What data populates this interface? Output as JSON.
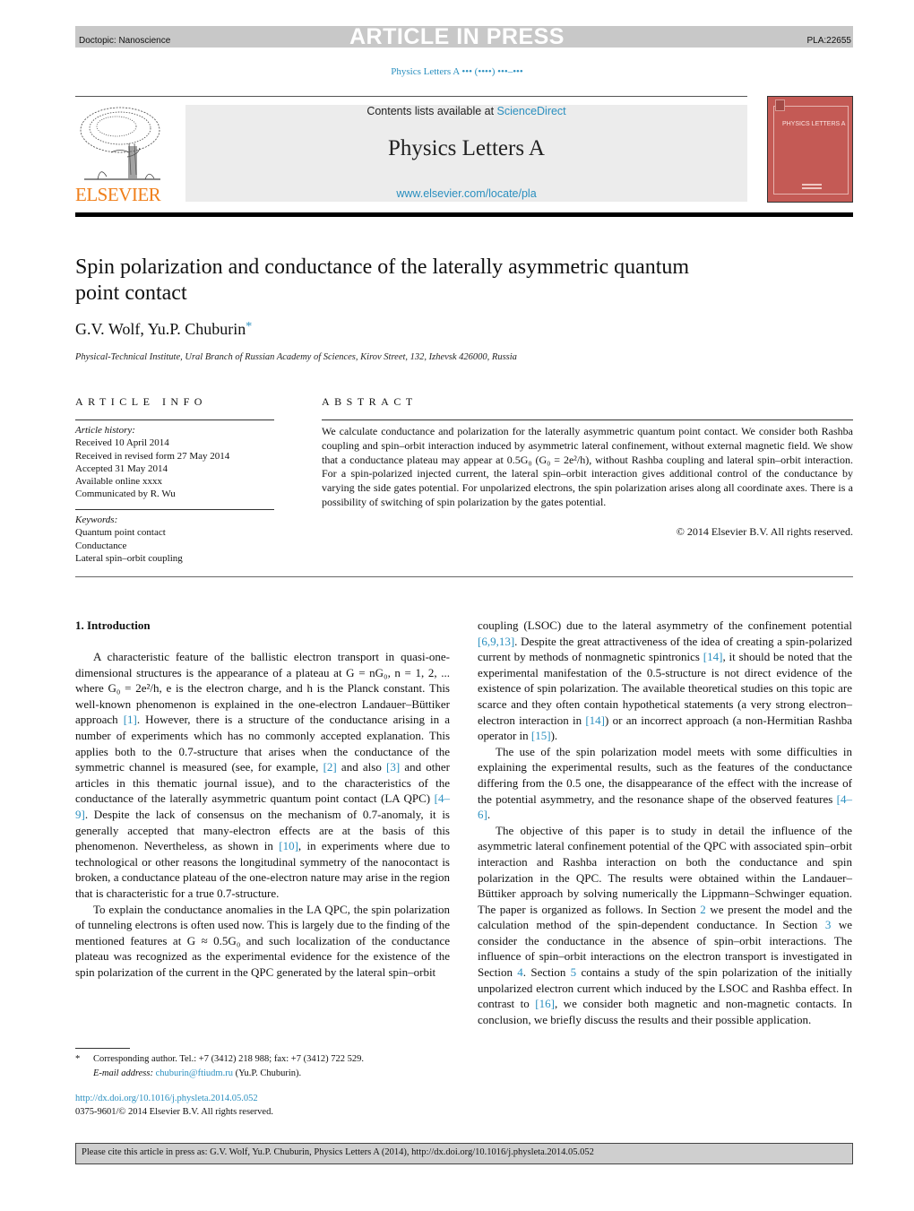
{
  "header": {
    "doctopic": "Doctopic: Nanoscience",
    "press_label": "ARTICLE IN PRESS",
    "article_code": "PLA:22655",
    "journal_citation": "Physics Letters A ••• (••••) •••–•••"
  },
  "masthead": {
    "contents_prefix": "Contents lists available at ",
    "contents_link": "ScienceDirect",
    "journal_name": "Physics Letters A",
    "journal_url": "www.elsevier.com/locate/pla",
    "publisher": "ELSEVIER",
    "cover_title": "PHYSICS LETTERS A",
    "cover_color": "#c45a55",
    "publisher_color": "#f07f1a",
    "link_color": "#2a8fbf"
  },
  "article": {
    "title": "Spin polarization and conductance of the laterally asymmetric quantum point contact",
    "authors": "G.V. Wolf, Yu.P. Chuburin",
    "author_marker": "*",
    "affiliation": "Physical-Technical Institute, Ural Branch of Russian Academy of Sciences, Kirov Street, 132, Izhevsk 426000, Russia"
  },
  "article_info": {
    "heading": "ARTICLE INFO",
    "history_label": "Article history:",
    "history": [
      "Received 10 April 2014",
      "Received in revised form 27 May 2014",
      "Accepted 31 May 2014",
      "Available online xxxx",
      "Communicated by R. Wu"
    ],
    "keywords_label": "Keywords:",
    "keywords": [
      "Quantum point contact",
      "Conductance",
      "Lateral spin–orbit coupling"
    ]
  },
  "abstract": {
    "heading": "ABSTRACT",
    "text": "We calculate conductance and polarization for the laterally asymmetric quantum point contact. We consider both Rashba coupling and spin–orbit interaction induced by asymmetric lateral confinement, without external magnetic field. We show that a conductance plateau may appear at 0.5G₀ (G₀ = 2e²/h), without Rashba coupling and lateral spin–orbit interaction. For a spin-polarized injected current, the lateral spin–orbit interaction gives additional control of the conductance by varying the side gates potential. For unpolarized electrons, the spin polarization arises along all coordinate axes. There is a possibility of switching of spin polarization by the gates potential.",
    "copyright": "© 2014 Elsevier B.V. All rights reserved."
  },
  "body": {
    "section_heading": "1. Introduction",
    "left_col": [
      {
        "t": "A characteristic feature of the ballistic electron transport in quasi-one-dimensional structures is the appearance of a plateau at G = nG₀, n = 1, 2, ... where G₀ = 2e²/h, e is the electron charge, and h is the Planck constant. This well-known phenomenon is explained in the one-electron Landauer–Büttiker approach "
      },
      {
        "l": "[1]"
      },
      {
        "t": ". However, there is a structure of the conductance arising in a number of experiments which has no commonly accepted explanation. This applies both to the 0.7-structure that arises when the conductance of the symmetric channel is measured (see, for example, "
      },
      {
        "l": "[2]"
      },
      {
        "t": " and also "
      },
      {
        "l": "[3]"
      },
      {
        "t": " and other articles in this thematic journal issue), and to the characteristics of the conductance of the laterally asymmetric quantum point contact (LA QPC) "
      },
      {
        "l": "[4–9]"
      },
      {
        "t": ". Despite the lack of consensus on the mechanism of 0.7-anomaly, it is generally accepted that many-electron effects are at the basis of this phenomenon. Nevertheless, as shown in "
      },
      {
        "l": "[10]"
      },
      {
        "t": ", in experiments where due to technological or other reasons the longitudinal symmetry of the nanocontact is broken, a conductance plateau of the one-electron nature may arise in the region that is characteristic for a true 0.7-structure."
      }
    ],
    "left_col_p2": "To explain the conductance anomalies in the LA QPC, the spin polarization of tunneling electrons is often used now. This is largely due to the finding of the mentioned features at G ≈ 0.5G₀ and such localization of the conductance plateau was recognized as the experimental evidence for the existence of the spin polarization of the current in the QPC generated by the lateral spin–orbit",
    "right_p1": [
      {
        "t": "coupling (LSOC) due to the lateral asymmetry of the confinement potential "
      },
      {
        "l": "[6,9,13]"
      },
      {
        "t": ". Despite the great attractiveness of the idea of creating a spin-polarized current by methods of nonmagnetic spintronics "
      },
      {
        "l": "[14]"
      },
      {
        "t": ", it should be noted that the experimental manifestation of the 0.5-structure is not direct evidence of the existence of spin polarization. The available theoretical studies on this topic are scarce and they often contain hypothetical statements (a very strong electron–electron interaction in "
      },
      {
        "l": "[14]"
      },
      {
        "t": ") or an incorrect approach (a non-Hermitian Rashba operator in "
      },
      {
        "l": "[15]"
      },
      {
        "t": ")."
      }
    ],
    "right_p2": [
      {
        "t": "The use of the spin polarization model meets with some difficulties in explaining the experimental results, such as the features of the conductance differing from the 0.5 one, the disappearance of the effect with the increase of the potential asymmetry, and the resonance shape of the observed features "
      },
      {
        "l": "[4–6]"
      },
      {
        "t": "."
      }
    ],
    "right_p3": [
      {
        "t": "The objective of this paper is to study in detail the influence of the asymmetric lateral confinement potential of the QPC with associated spin–orbit interaction and Rashba interaction on both the conductance and spin polarization in the QPC. The results were obtained within the Landauer–Büttiker approach by solving numerically the Lippmann–Schwinger equation. The paper is organized as follows. In Section "
      },
      {
        "l": "2"
      },
      {
        "t": " we present the model and the calculation method of the spin-dependent conductance. In Section "
      },
      {
        "l": "3"
      },
      {
        "t": " we consider the conductance in the absence of spin–orbit interactions. The influence of spin–orbit interactions on the electron transport is investigated in Section "
      },
      {
        "l": "4"
      },
      {
        "t": ". Section "
      },
      {
        "l": "5"
      },
      {
        "t": " contains a study of the spin polarization of the initially unpolarized electron current which induced by the LSOC and Rashba effect. In contrast to "
      },
      {
        "l": "[16]"
      },
      {
        "t": ", we consider both magnetic and non-magnetic contacts. In conclusion, we briefly discuss the results and their possible application."
      }
    ]
  },
  "footnote": {
    "marker": "*",
    "contact": "Corresponding author. Tel.: +7 (3412) 218 988; fax: +7 (3412) 722 529.",
    "email_label": "E-mail address: ",
    "email": "chuburin@ftiudm.ru",
    "email_owner": " (Yu.P. Chuburin)."
  },
  "doi": {
    "url": "http://dx.doi.org/10.1016/j.physleta.2014.05.052",
    "issn_line": "0375-9601/© 2014 Elsevier B.V. All rights reserved."
  },
  "citation_bar": {
    "text": "Please cite this article in press as: G.V. Wolf, Yu.P. Chuburin, Physics Letters A (2014), http://dx.doi.org/10.1016/j.physleta.2014.05.052"
  }
}
